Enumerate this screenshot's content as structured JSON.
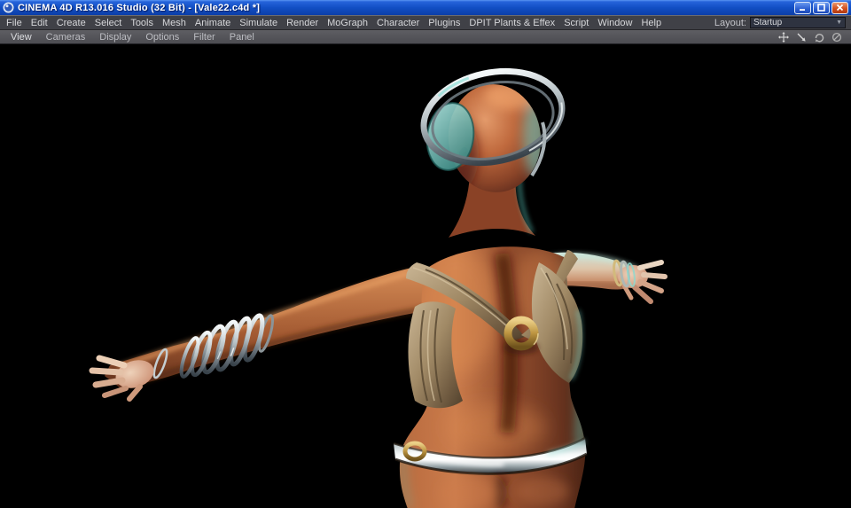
{
  "window": {
    "title": "CINEMA 4D R13.016 Studio (32 Bit) - [Vale22.c4d *]",
    "controls": [
      "minimize",
      "maximize",
      "close"
    ]
  },
  "menu_bar": {
    "items": [
      "File",
      "Edit",
      "Create",
      "Select",
      "Tools",
      "Mesh",
      "Animate",
      "Simulate",
      "Render",
      "MoGraph",
      "Character",
      "Plugins",
      "DPIT Plants & Effex",
      "Script",
      "Window",
      "Help"
    ],
    "layout": {
      "label": "Layout:",
      "value": "Startup"
    }
  },
  "viewport_bar": {
    "items": [
      "View",
      "Cameras",
      "Display",
      "Options",
      "Filter",
      "Panel"
    ],
    "nav_icons": [
      "pan-view-icon",
      "zoom-view-icon",
      "rotate-view-icon",
      "toggle-active-view-icon"
    ]
  },
  "colors": {
    "title_top": "#5a96f2",
    "title_bottom": "#0c3ea8",
    "close_red": "#d2501e",
    "menubar_bg": "#404147",
    "toolbar_bg": "#4c4c51",
    "text_light": "#d6d7da",
    "viewport_bg": "#000000",
    "skin_highlight": "#e09268",
    "skin_mid": "#b5683f",
    "skin_shadow": "#5d2a1a",
    "rim_teal": "#6fd4cc",
    "fabric_tan": "#a18a66",
    "metal_silver": "#dfe6e8",
    "gold": "#c9a34f"
  }
}
